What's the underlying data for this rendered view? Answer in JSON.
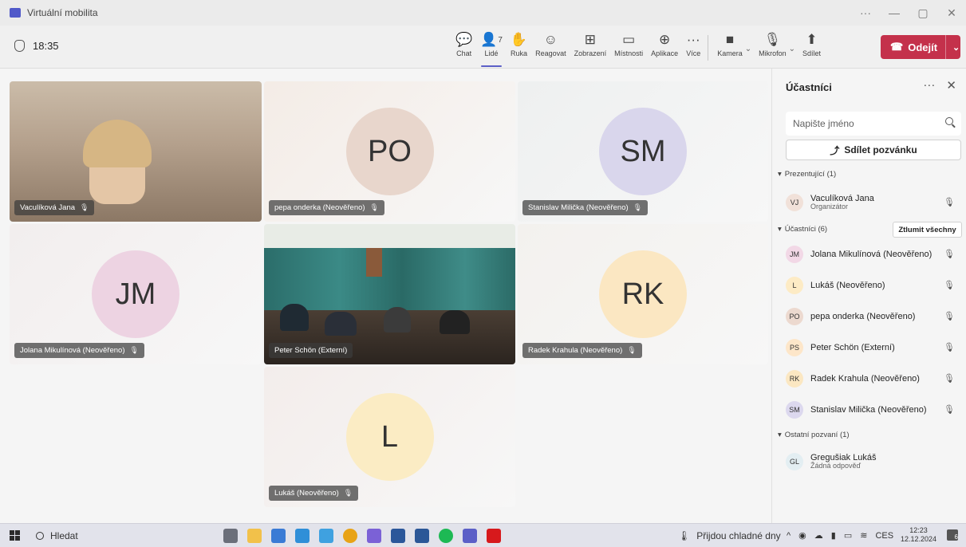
{
  "window": {
    "title": "Virtuální mobilita",
    "more": "···",
    "minimize": "—",
    "restore": "▢",
    "close": "✕"
  },
  "meeting": {
    "timer": "18:35"
  },
  "toolbar": {
    "chat": "Chat",
    "people": "Lidé",
    "people_count": "7",
    "raise_hand": "Ruka",
    "react": "Reagovat",
    "view": "Zobrazení",
    "rooms": "Místnosti",
    "apps": "Aplikace",
    "more": "Více",
    "camera": "Kamera",
    "mic": "Mikrofon",
    "share": "Sdílet",
    "leave": "Odejít"
  },
  "tiles": [
    {
      "name": "Vaculíková Jana",
      "initials": "",
      "video": true,
      "bg": "#b89f86"
    },
    {
      "name": "pepa onderka (Neověřeno)",
      "initials": "PO",
      "video": false,
      "bg": "#f4ece6",
      "avbg": "#e8d6cc"
    },
    {
      "name": "Stanislav Milička (Neověřeno)",
      "initials": "SM",
      "video": false,
      "bg": "#eef0f0",
      "avbg": "#d9d6ec"
    },
    {
      "name": "Jolana Mikulínová (Neověřeno)",
      "initials": "JM",
      "video": false,
      "bg": "#f2eeee",
      "avbg": "#edd3e2"
    },
    {
      "name": "Peter Schön (Externí)",
      "initials": "",
      "video": true,
      "bg": "#26352f"
    },
    {
      "name": "Radek Krahula (Neověřeno)",
      "initials": "RK",
      "video": false,
      "bg": "#f3f1ee",
      "avbg": "#fbe7c2"
    },
    {
      "name": "Lukáš (Neověřeno)",
      "initials": "L",
      "video": false,
      "bg": "#f3edeb",
      "avbg": "#fbecc4"
    }
  ],
  "panel": {
    "title": "Účastníci",
    "search_placeholder": "Napište jméno",
    "invite": "Sdílet pozvánku",
    "presenters_label": "Prezentující (1)",
    "attendees_label": "Účastníci (6)",
    "mute_all": "Ztlumit všechny",
    "others_label": "Ostatní pozvaní (1)",
    "presenter": {
      "initials": "VJ",
      "name": "Vaculíková Jana",
      "role": "Organizátor"
    },
    "attendees": [
      {
        "initials": "JM",
        "name": "Jolana Mikulínová (Neověřeno)",
        "muted": true,
        "avbg": "#f2d8e6"
      },
      {
        "initials": "L",
        "name": "Lukáš (Neověřeno)",
        "muted": true,
        "avbg": "#fdebc5"
      },
      {
        "initials": "PO",
        "name": "pepa onderka (Neověřeno)",
        "muted": true,
        "avbg": "#ecd9cf"
      },
      {
        "initials": "PS",
        "name": "Peter Schön (Externí)",
        "muted": false,
        "avbg": "#fde6c9"
      },
      {
        "initials": "RK",
        "name": "Radek Krahula (Neověřeno)",
        "muted": true,
        "avbg": "#fbe7c2"
      },
      {
        "initials": "SM",
        "name": "Stanislav Milička (Neověřeno)",
        "muted": true,
        "avbg": "#dcd8ee"
      }
    ],
    "other": {
      "initials": "GL",
      "name": "Gregušiak Lukáš",
      "status": "Žádná odpověď"
    }
  },
  "taskbar": {
    "search": "Hledat",
    "weather": "Přijdou chladné dny",
    "lang": "CES",
    "time": "12:23",
    "date": "12.12.2024",
    "notif": "6"
  },
  "colors": {
    "accent": "#5b5fc7",
    "leave": "#c4314b"
  }
}
